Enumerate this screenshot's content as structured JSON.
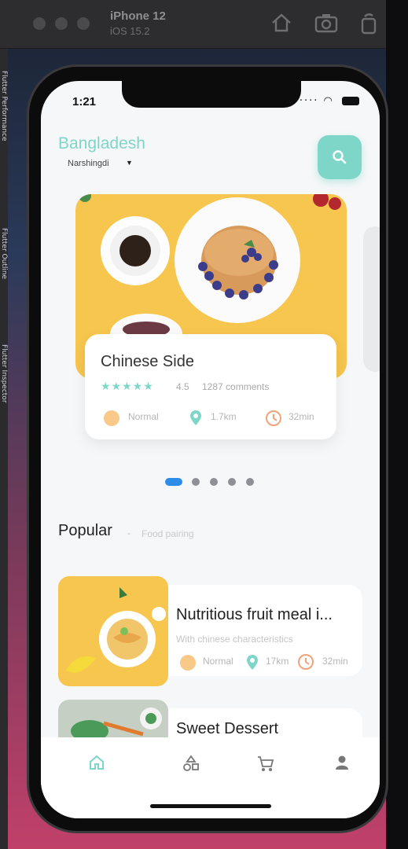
{
  "simulator": {
    "device": "iPhone 12",
    "os": "iOS 15.2"
  },
  "devtools": {
    "labels": [
      "Flutter Performance",
      "Flutter Outline",
      "Flutter Inspector"
    ]
  },
  "status_bar": {
    "time": "1:21"
  },
  "location": {
    "country": "Bangladesh",
    "region": "Narshingdi"
  },
  "featured": {
    "title": "Chinese Side",
    "rating": "4.5",
    "comments": "1287 comments",
    "difficulty": "Normal",
    "distance": "1.7km",
    "time": "32min"
  },
  "carousel": {
    "count": 5,
    "active": 0
  },
  "popular": {
    "title": "Popular",
    "dash": "-",
    "subtitle": "Food pairing",
    "items": [
      {
        "title": "Nutritious fruit meal i...",
        "subtitle": "With chinese characteristics",
        "difficulty": "Normal",
        "distance": "17km",
        "time": "32min"
      },
      {
        "title": "Sweet Dessert"
      }
    ]
  },
  "bottom_nav": [
    "home-icon",
    "apps-icon",
    "cart-icon",
    "profile-icon"
  ],
  "colors": {
    "accent": "#7ed6c8",
    "orange": "#f9c98a",
    "active_indicator": "#2b8de8"
  }
}
